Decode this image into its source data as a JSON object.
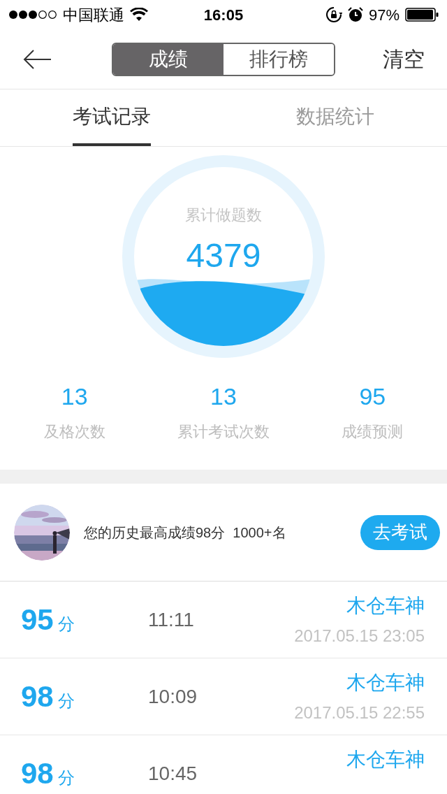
{
  "status_bar": {
    "carrier": "中国联通",
    "time": "16:05",
    "battery": "97%"
  },
  "nav": {
    "segments": [
      {
        "label": "成绩",
        "selected": true
      },
      {
        "label": "排行榜",
        "selected": false
      }
    ],
    "action": "清空"
  },
  "tabs": [
    {
      "label": "考试记录",
      "selected": true
    },
    {
      "label": "数据统计",
      "selected": false
    }
  ],
  "gauge": {
    "label": "累计做题数",
    "value": "4379"
  },
  "stats": [
    {
      "value": "13",
      "label": "及格次数"
    },
    {
      "value": "13",
      "label": "累计考试次数"
    },
    {
      "value": "95",
      "label": "成绩预测"
    }
  ],
  "best": {
    "text": "您的历史最高成绩98分  1000+名",
    "button": "去考试"
  },
  "records": [
    {
      "score": "95",
      "unit": "分",
      "duration": "11:11",
      "name": "木仓车神",
      "date": "2017.05.15 23:05"
    },
    {
      "score": "98",
      "unit": "分",
      "duration": "10:09",
      "name": "木仓车神",
      "date": "2017.05.15 22:55"
    },
    {
      "score": "98",
      "unit": "分",
      "duration": "10:45",
      "name": "木仓车神"
    }
  ]
}
